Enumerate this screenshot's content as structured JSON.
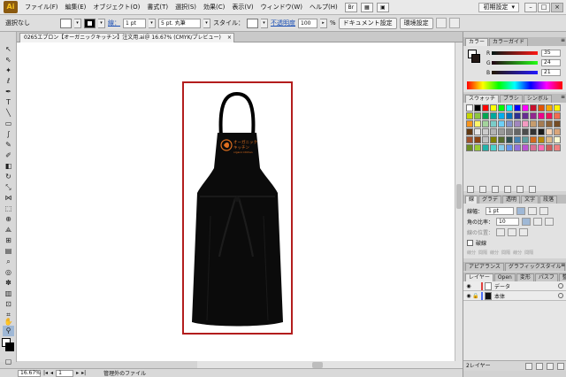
{
  "menubar": {
    "logo": "Ai",
    "items": [
      "ファイル(F)",
      "編集(E)",
      "オブジェクト(O)",
      "書式(T)",
      "選択(S)",
      "効果(C)",
      "表示(V)",
      "ウィンドウ(W)",
      "ヘルプ(H)"
    ],
    "workspace": "初期設定",
    "workspace_arrow": "▾"
  },
  "controlbar": {
    "selection": "選択なし",
    "stroke_label": "線：",
    "stroke_weight": "1 pt",
    "brush": "5 pt. 丸筆",
    "style_label": "スタイル：",
    "opacity_label": "不透明度",
    "opacity_value": "100",
    "percent": "%",
    "doc_setup_button": "ドキュメント設定",
    "prefs_button": "環境設定"
  },
  "document": {
    "tab_title": "0265エプロン【オーガニックキッチン】注文用.ai＠ 16.67% (CMYK/プレビュー)",
    "close": "×"
  },
  "artwork": {
    "logo_line1": "オーガニック",
    "logo_line2": "キッチン",
    "logo_line3": "organic kitchen",
    "logo_color": "#e07020"
  },
  "statusbar": {
    "zoom": "16.67%",
    "first": "|◂",
    "prev": "◂",
    "page": "1",
    "next": "▸",
    "last": "▸|",
    "info": "管理外のファイル"
  },
  "color_panel": {
    "tabs": [
      "カラー",
      "カラーガイド"
    ],
    "channels": [
      {
        "name": "R",
        "value": "35"
      },
      {
        "name": "G",
        "value": "24"
      },
      {
        "name": "B",
        "value": "21"
      }
    ]
  },
  "swatches_panel": {
    "tabs": [
      "スウォッチ",
      "ブラシ",
      "シンボル"
    ],
    "colors": [
      "#ffffff",
      "#000000",
      "#ff0000",
      "#ffff00",
      "#00ff00",
      "#00ffff",
      "#0000ff",
      "#ff00ff",
      "#c8102e",
      "#e35205",
      "#f7a800",
      "#fff200",
      "#c4d600",
      "#8dc63f",
      "#00a651",
      "#00a99d",
      "#00aeef",
      "#0072bc",
      "#2e3192",
      "#662d91",
      "#92278f",
      "#ec008c",
      "#ed145b",
      "#f26c4f",
      "#f7941d",
      "#fff568",
      "#a3d39c",
      "#7accc8",
      "#6dcff6",
      "#8393ca",
      "#a186be",
      "#f49ac1",
      "#c69c6d",
      "#a67c52",
      "#8c6239",
      "#754c24",
      "#603913",
      "#e6e6e6",
      "#cccccc",
      "#b3b3b3",
      "#999999",
      "#808080",
      "#666666",
      "#4d4d4d",
      "#333333",
      "#1a1a1a",
      "#f5d2b3",
      "#d9a57a",
      "#a0522d",
      "#8b4513",
      "#c0c0c0",
      "#808000",
      "#556b2f",
      "#2f4f4f",
      "#4682b4",
      "#5f9ea0",
      "#d2691e",
      "#b8860b",
      "#deb887",
      "#fafad2",
      "#6b8e23",
      "#9acd32",
      "#20b2aa",
      "#48d1cc",
      "#87ceeb",
      "#6495ed",
      "#9370db",
      "#ba55d3",
      "#db7093",
      "#ff69b4",
      "#cd5c5c",
      "#f08080"
    ]
  },
  "stroke_panel": {
    "tabs": [
      "線",
      "グラデ",
      "透明",
      "文字",
      "段落"
    ],
    "weight_label": "線幅：",
    "weight_value": "1 pt",
    "miter_label": "角の比率：",
    "miter_value": "10",
    "align_label": "線の位置：",
    "dashed_label": "破線",
    "dash_labels": [
      "線分",
      "間隔",
      "線分",
      "間隔",
      "線分",
      "間隔"
    ]
  },
  "appearance_panel": {
    "tabs": [
      "アピアランス",
      "グラフィックスタイル"
    ]
  },
  "layers_panel": {
    "tabs": [
      "レイヤー",
      "Open",
      "変形",
      "パスフ",
      "整列"
    ],
    "layers": [
      {
        "name": "データ",
        "color": "#e0413f",
        "locked": false,
        "visible": true
      },
      {
        "name": "本体",
        "color": "#4c6ef5",
        "locked": true,
        "visible": true
      }
    ],
    "footer": "2レイヤー"
  }
}
